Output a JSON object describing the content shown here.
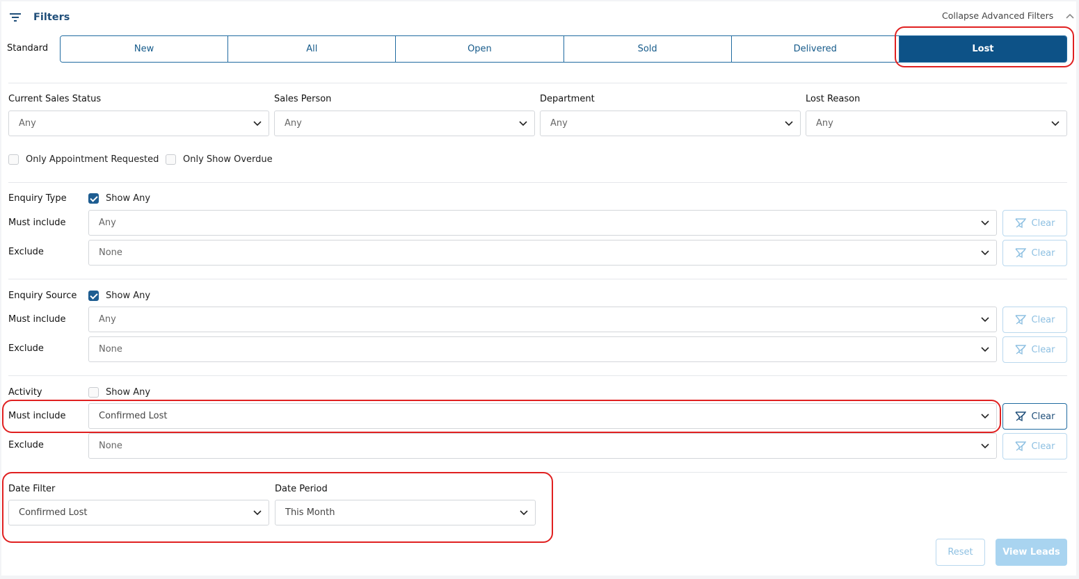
{
  "header": {
    "title": "Filters",
    "collapse_label": "Collapse Advanced Filters"
  },
  "standard": {
    "label": "Standard",
    "tabs": [
      {
        "label": "New",
        "active": false
      },
      {
        "label": "All",
        "active": false
      },
      {
        "label": "Open",
        "active": false
      },
      {
        "label": "Sold",
        "active": false
      },
      {
        "label": "Delivered",
        "active": false
      },
      {
        "label": "Lost",
        "active": true
      }
    ]
  },
  "filters": {
    "current_sales_status": {
      "label": "Current Sales Status",
      "value": "Any"
    },
    "sales_person": {
      "label": "Sales Person",
      "value": "Any"
    },
    "department": {
      "label": "Department",
      "value": "Any"
    },
    "lost_reason": {
      "label": "Lost Reason",
      "value": "Any"
    }
  },
  "checkboxes": {
    "appointment": {
      "label": "Only Appointment Requested",
      "checked": false
    },
    "overdue": {
      "label": "Only Show Overdue",
      "checked": false
    }
  },
  "groups": {
    "enquiry_type": {
      "label": "Enquiry Type",
      "show_any_label": "Show Any",
      "show_any": true,
      "must_label": "Must include",
      "must_value": "Any",
      "exclude_label": "Exclude",
      "exclude_value": "None"
    },
    "enquiry_source": {
      "label": "Enquiry Source",
      "show_any_label": "Show Any",
      "show_any": true,
      "must_label": "Must include",
      "must_value": "Any",
      "exclude_label": "Exclude",
      "exclude_value": "None"
    },
    "activity": {
      "label": "Activity",
      "show_any_label": "Show Any",
      "show_any": false,
      "must_label": "Must include",
      "must_value": "Confirmed Lost",
      "exclude_label": "Exclude",
      "exclude_value": "None"
    }
  },
  "clear_label": "Clear",
  "date": {
    "filter_label": "Date Filter",
    "filter_value": "Confirmed Lost",
    "period_label": "Date Period",
    "period_value": "This Month"
  },
  "actions": {
    "reset": "Reset",
    "view": "View Leads"
  },
  "colors": {
    "primary": "#0d5287",
    "highlight": "#e02020",
    "disabled": "#a9d4f0"
  }
}
